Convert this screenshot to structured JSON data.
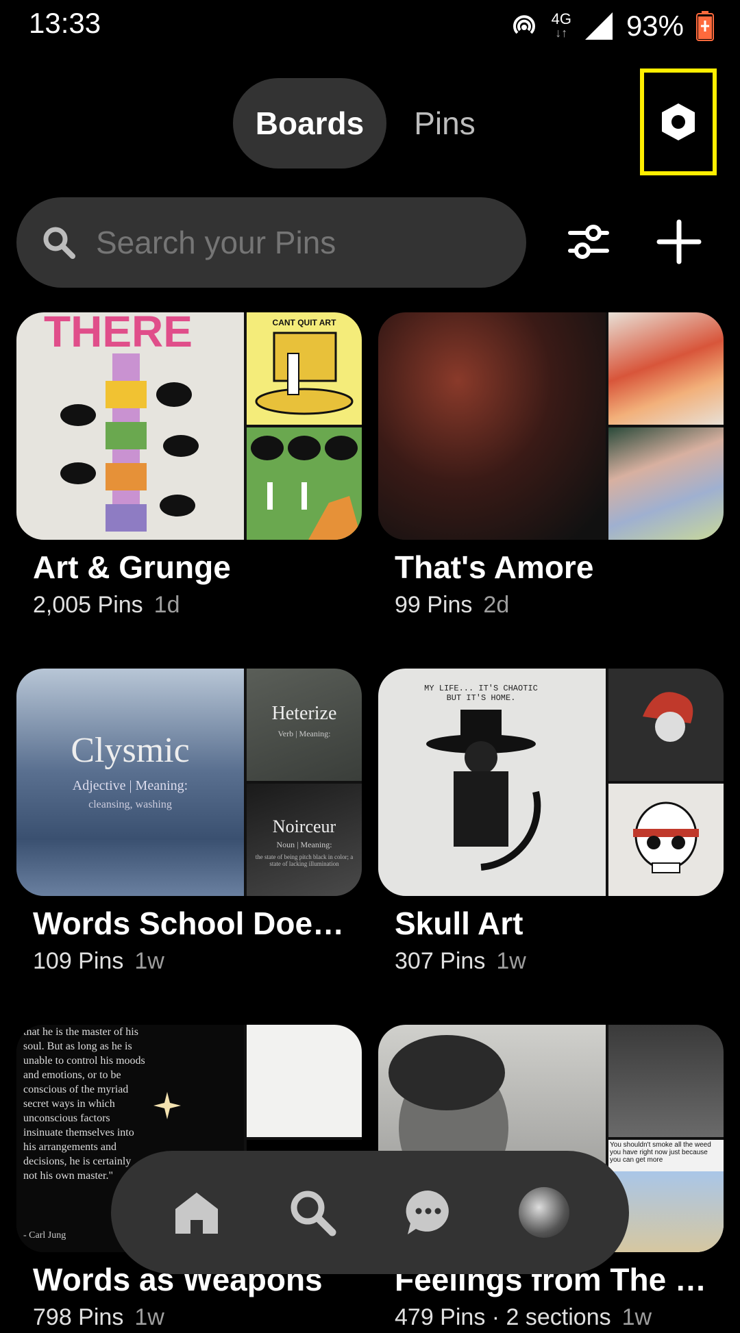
{
  "status_bar": {
    "time": "13:33",
    "network": "4G",
    "battery": "93%"
  },
  "tabs": {
    "boards_label": "Boards",
    "pins_label": "Pins"
  },
  "search": {
    "placeholder": "Search your Pins"
  },
  "boards": [
    {
      "title": "Art & Grunge",
      "pins": "2,005 Pins",
      "age": "1d"
    },
    {
      "title": "That's Amore",
      "pins": "99 Pins",
      "age": "2d"
    },
    {
      "title": "Words School Does…",
      "pins": "109 Pins",
      "age": "1w"
    },
    {
      "title": "Skull Art",
      "pins": "307 Pins",
      "age": "1w"
    },
    {
      "title": "Words as Weapons",
      "pins": "798 Pins",
      "age": "1w"
    },
    {
      "title": "Feelings from The …",
      "pins": "479 Pins · 2 sections",
      "age": "1w"
    }
  ],
  "tiles": {
    "cant_quit_art": "CANT QUIT ART",
    "clysmic": "Clysmic",
    "clysmic_sub": "Adjective | Meaning:",
    "clysmic_def": "cleansing, washing",
    "heterize": "Heterize",
    "heterize_sub": "Verb | Meaning:",
    "noirceur": "Noirceur",
    "noirceur_sub": "Noun | Meaning:",
    "noirceur_def": "the state of being pitch black in color; a state of lacking illumination",
    "skull_quote": "MY LIFE... IT'S CHAOTIC BUT IT'S HOME.",
    "jung_quote": "that he is the master of his soul. But as long as he is unable to control his moods and emotions, or to be conscious of the myriad secret ways in which unconscious factors insinuate themselves into his arrangements and decisions, he is certainly not his own master.\"",
    "jung_author": "- Carl Jung",
    "weed_quote": "You shouldn't smoke all the weed you have right now just because you can get more"
  },
  "colors": {
    "accent_highlight": "#ffee00",
    "surface": "#333333",
    "battery_accent": "#ff6a3d"
  },
  "icons": [
    "hotspot-icon",
    "signal-icon",
    "battery-icon",
    "settings-hex-icon",
    "search-icon",
    "filter-icon",
    "plus-icon",
    "home-icon",
    "search-nav-icon",
    "chat-icon"
  ]
}
